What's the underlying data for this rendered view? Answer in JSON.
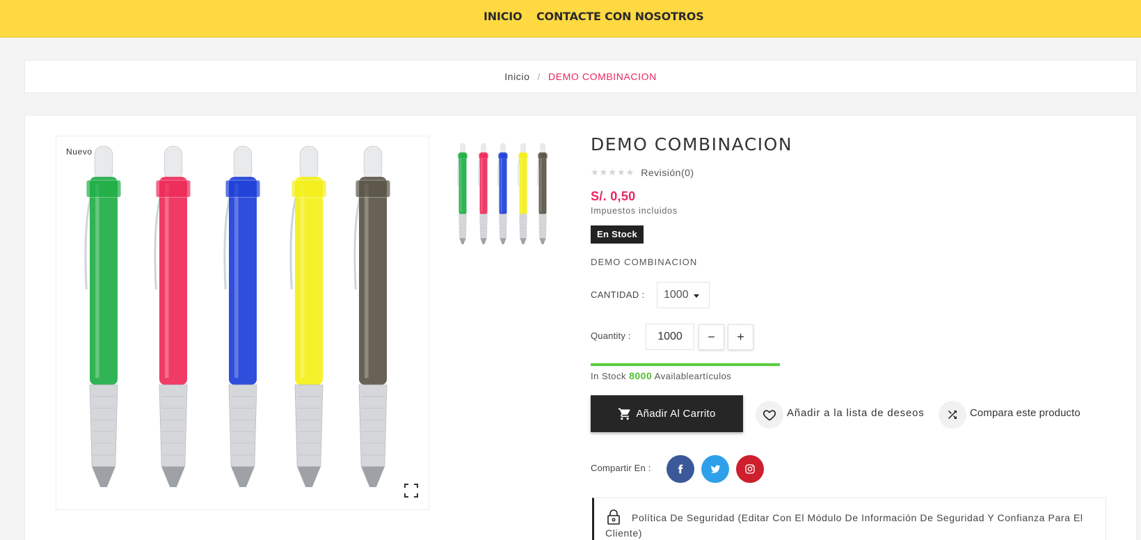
{
  "nav": {
    "items": [
      {
        "label": "INICIO"
      },
      {
        "label": "CONTACTE CON NOSOTROS"
      }
    ],
    "background_color": "#ffd942"
  },
  "breadcrumb": {
    "home": "Inicio",
    "separator": "/",
    "current": "DEMO COMBINACION"
  },
  "gallery": {
    "badge": "Nuevo",
    "expand_icon": "fullscreen-expand-icon",
    "pen_colors": [
      "#1fae45",
      "#ee2a58",
      "#1d3fd8",
      "#f3f019",
      "#5b5548"
    ]
  },
  "product": {
    "title": "DEMO COMBINACION",
    "rating_stars": 0,
    "rating_max": 5,
    "review_label": "Revisión(0)",
    "price": "S/. 0,50",
    "tax_note": "Impuestos incluidos",
    "stock_badge": "En Stock",
    "short_description": "DEMO COMBINACION",
    "accent_color": "#e8265f"
  },
  "options": {
    "cantidad_label": "CANTIDAD :",
    "cantidad_selected": "1000",
    "quantity_label": "Quantity :",
    "quantity_value": "1000",
    "minus_symbol": "−",
    "plus_symbol": "+"
  },
  "stock": {
    "prefix": "In Stock",
    "count": "8000",
    "suffix": "Availableartículos",
    "level_fraction": 1.0
  },
  "actions": {
    "add_to_cart": "Añadir Al Carrito",
    "wishlist": "Añadir a la lista de deseos",
    "compare": "Compara este producto"
  },
  "share": {
    "label": "Compartir En :",
    "networks": [
      "facebook-icon",
      "twitter-icon",
      "instagram-icon"
    ]
  },
  "policy": {
    "text": "Política De Seguridad (Editar Con El Módulo De Información De Seguridad Y Confianza Para El Cliente)"
  }
}
